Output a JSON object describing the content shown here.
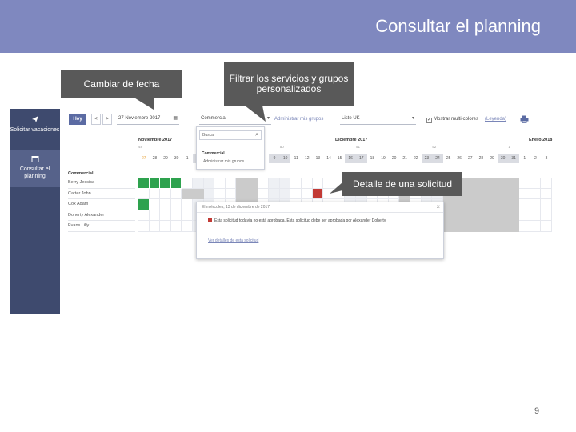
{
  "slide": {
    "title": "Consultar el planning",
    "page_number": "9",
    "header_color": "#7f88bf"
  },
  "callouts": {
    "change_date": "Cambiar de fecha",
    "filter_services": "Filtrar los servicios y grupos personalizados",
    "request_detail": "Detalle de una solicitud"
  },
  "sidebar": {
    "items": [
      {
        "label": "Solicitar vacaciones",
        "icon": "paper-plane-icon"
      },
      {
        "label": "Consultar el planning",
        "icon": "calendar-icon"
      }
    ]
  },
  "toolbar": {
    "today_label": "Hoy",
    "prev_label": "<",
    "next_label": ">",
    "date_value": "27 Noviembre 2017",
    "group_select": "Commercial",
    "manage_groups_link": "Administrar mis grupos",
    "location_select": "Liste UK",
    "multi_colors_label": "Mostrar multi-colores",
    "legend_link": "(Leyenda)",
    "print_icon": "printer-icon"
  },
  "calendar": {
    "months": [
      "Noviembre 2017",
      "Diciembre 2017",
      "Enero 2018"
    ],
    "weeks": [
      "48",
      "49",
      "50",
      "51",
      "52",
      "1"
    ],
    "days": [
      "27",
      "28",
      "29",
      "30",
      "1",
      "2",
      "3",
      "4",
      "5",
      "6",
      "7",
      "8",
      "9",
      "10",
      "11",
      "12",
      "13",
      "14",
      "15",
      "16",
      "17",
      "18",
      "19",
      "20",
      "21",
      "22",
      "23",
      "24",
      "25",
      "26",
      "27",
      "28",
      "29",
      "30",
      "31",
      "1",
      "2",
      "3"
    ],
    "group": "Commercial",
    "employees": [
      "Berry Jessica",
      "Carter John",
      "Cox Adam",
      "Doherty Alexander",
      "Evans Lilly"
    ],
    "colors": {
      "approved": "#2ea24e",
      "holiday": "#cbcbcb",
      "selected": "#c23a35"
    }
  },
  "dropdown": {
    "search_placeholder": "Buscar",
    "items": [
      "Commercial",
      "Administrar mis grupos"
    ]
  },
  "popup": {
    "title": "El miércoles, 13 de diciembre de 2017",
    "body": "Esta solicitud todavía no está aprobada. Esta solicitud debe ser aprobada por Alexander Doherty.",
    "link": "Ver detalles de esta solicitud"
  }
}
